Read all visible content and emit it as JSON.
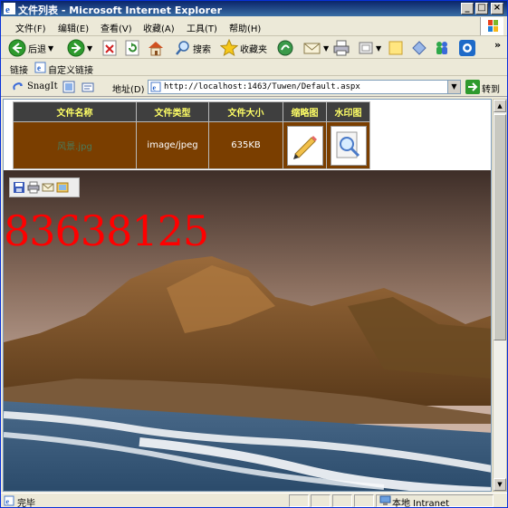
{
  "window": {
    "title": "文件列表 - Microsoft Internet Explorer",
    "controls": [
      "_",
      "□",
      "×"
    ]
  },
  "menu": [
    "文件(F)",
    "编辑(E)",
    "查看(V)",
    "收藏(A)",
    "工具(T)",
    "帮助(H)"
  ],
  "toolbar": {
    "back_label": "后退",
    "search_label": "搜索",
    "favorites_label": "收藏夹",
    "more": "»"
  },
  "links": {
    "label": "链接",
    "item": "自定义链接"
  },
  "addressbar": {
    "snagit_label": "SnagIt",
    "address_label": "地址(D)",
    "url": "http://localhost:1463/Tuwen/Default.aspx",
    "go_label": "转到"
  },
  "table": {
    "headers": [
      "文件名称",
      "文件类型",
      "文件大小",
      "缩略图",
      "水印图"
    ],
    "rows": [
      {
        "name": "风景.jpg",
        "type": "image/jpeg",
        "size": "635KB"
      }
    ]
  },
  "overlay": {
    "watermark_text": "83638125"
  },
  "status": {
    "text": "完毕",
    "zone": "本地 Intranet"
  },
  "colors": {
    "header_bg": "#3F3F3F",
    "header_text": "#FFFF66",
    "row_bg": "#7A3E00",
    "watermark": "#FF0000"
  }
}
